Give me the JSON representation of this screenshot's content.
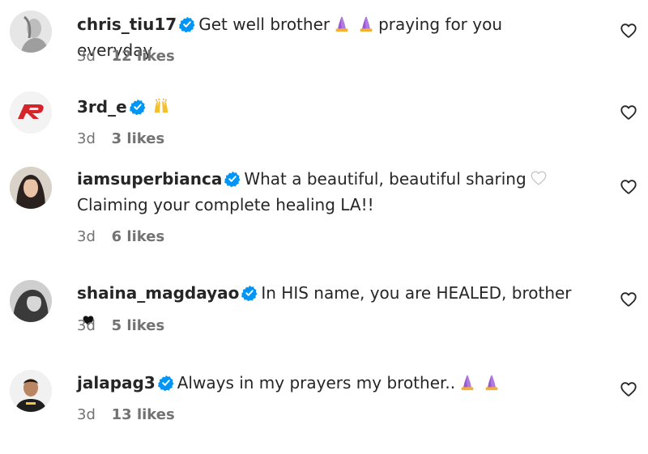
{
  "comments": [
    {
      "username": "chris_tiu17",
      "text_before": "Get well brother",
      "emojis": [
        "folded-hands",
        "folded-hands"
      ],
      "text_after": "praying for you everyday",
      "time": "3d",
      "likes": "12 likes"
    },
    {
      "username": "3rd_e",
      "emojis": [
        "raising-hands"
      ],
      "time": "3d",
      "likes": "3 likes"
    },
    {
      "username": "iamsuperbianca",
      "text_line1": "What a beautiful, beautiful sharing",
      "emoji_after": "white-heart",
      "text_line2": "Claiming your complete healing LA!!",
      "time": "3d",
      "likes": "6 likes"
    },
    {
      "username": "shaina_magdayao",
      "text_before": "In HIS name, you are HEALED, brother",
      "emojis": [
        "black-heart"
      ],
      "time": "3d",
      "likes": "5 likes"
    },
    {
      "username": "jalapag3",
      "text_before": "Always in my prayers my brother..",
      "emojis": [
        "folded-hands",
        "folded-hands"
      ],
      "time": "3d",
      "likes": "13 likes"
    }
  ],
  "colors": {
    "text": "#262626",
    "meta": "#737373",
    "verified": "#0095f6"
  },
  "icons": {
    "like": "heart-outline-icon",
    "verified": "verified-badge-icon"
  }
}
